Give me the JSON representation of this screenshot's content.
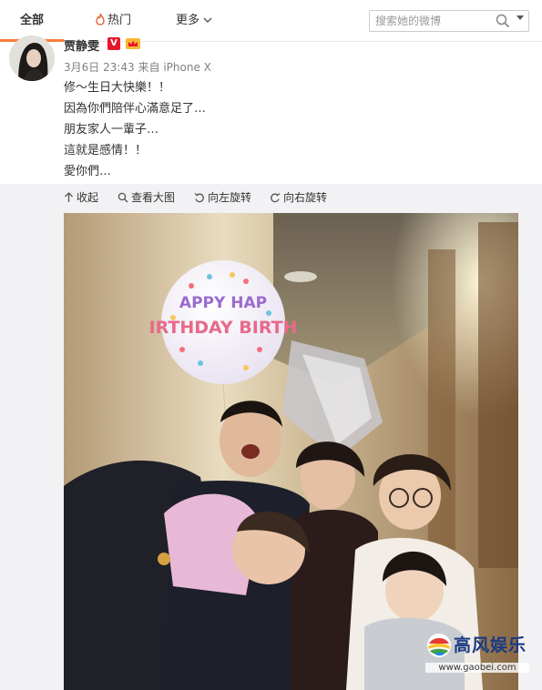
{
  "tabs": {
    "all": "全部",
    "hot": "热门",
    "more": "更多"
  },
  "search": {
    "placeholder": "搜索她的微博"
  },
  "post": {
    "username": "贾静雯",
    "verified_badge": "V",
    "time": "3月6日 23:43",
    "source": "来自 iPhone X",
    "lines": [
      "修～生日大快樂！！",
      "因為你們陪伴心滿意足了…",
      "朋友家人一輩子…",
      "這就是感情！！",
      "愛你們…"
    ]
  },
  "media_toolbar": {
    "collapse": "收起",
    "view_large": "查看大图",
    "rotate_left": "向左旋转",
    "rotate_right": "向右旋转"
  },
  "photo": {
    "balloon_text_top": "APPY HAP",
    "balloon_text_bottom": "IRTHDAY BIRTH"
  },
  "watermark": {
    "title": "高风娱乐",
    "url": "www.gaobei.com"
  },
  "colors": {
    "accent": "#fa7d3c",
    "verified": "#e6162d",
    "media_bg": "#f2f2f5",
    "watermark": "#1a3a82"
  },
  "icons": [
    "fire-icon",
    "chevron-down-icon",
    "search-icon",
    "vip-crown-icon",
    "collapse-icon",
    "zoom-icon",
    "rotate-left-icon",
    "rotate-right-icon",
    "logo-icon"
  ]
}
